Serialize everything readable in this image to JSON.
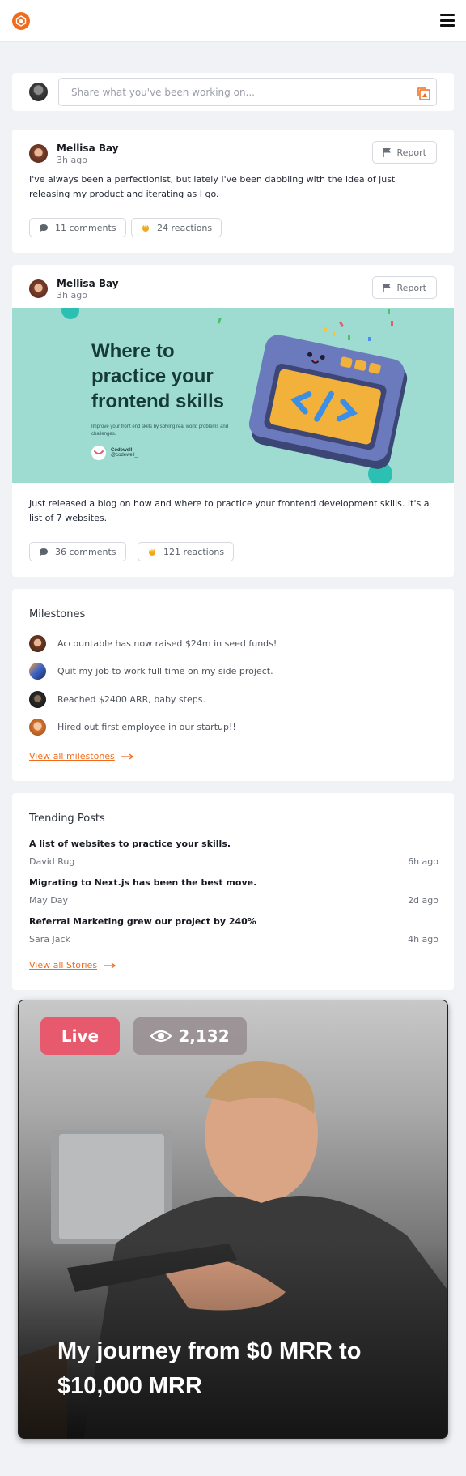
{
  "composer": {
    "placeholder": "Share what you've been working on..."
  },
  "posts": [
    {
      "author": "Mellisa Bay",
      "time": "3h ago",
      "report_label": "Report",
      "text": "I've always been a perfectionist, but lately I've been dabbling with the idea of just releasing my product and iterating as I go.",
      "comments": "11 comments",
      "reactions": "24 reactions"
    },
    {
      "author": "Mellisa Bay",
      "time": "3h ago",
      "report_label": "Report",
      "image": {
        "title_line1": "Where to",
        "title_line2": "practice your",
        "title_line3": "frontend skills",
        "subtitle": "Improve your front end skills by solving real world problems and challenges.",
        "brand_name": "Codewell",
        "brand_handle": "@codewell_"
      },
      "text": "Just released a blog on how and where to practice your frontend development skills. It's a list of 7 websites.",
      "comments": "36 comments",
      "reactions": "121 reactions"
    }
  ],
  "milestones": {
    "title": "Milestones",
    "items": [
      {
        "text": "Accountable has now raised $24m in seed funds!"
      },
      {
        "text": "Quit my job to work full time on my side project."
      },
      {
        "text": "Reached $2400 ARR, baby steps."
      },
      {
        "text": "Hired out first employee in our startup!!"
      }
    ],
    "view_all": "View all milestones"
  },
  "trending": {
    "title": "Trending Posts",
    "items": [
      {
        "title": "A list of websites to practice your skills.",
        "author": "David Rug",
        "time": "6h ago"
      },
      {
        "title": "Migrating to Next.js has been the best move.",
        "author": "May Day",
        "time": "2d ago"
      },
      {
        "title": "Referral Marketing grew our project by 240%",
        "author": "Sara Jack",
        "time": "4h ago"
      }
    ],
    "view_all": "View all Stories"
  },
  "live": {
    "badge": "Live",
    "viewers": "2,132",
    "title": "My journey from $0 MRR to $10,000 MRR"
  },
  "colors": {
    "accent": "#f26b1d",
    "live": "#e75a6d",
    "teal": "#9edcd2"
  }
}
